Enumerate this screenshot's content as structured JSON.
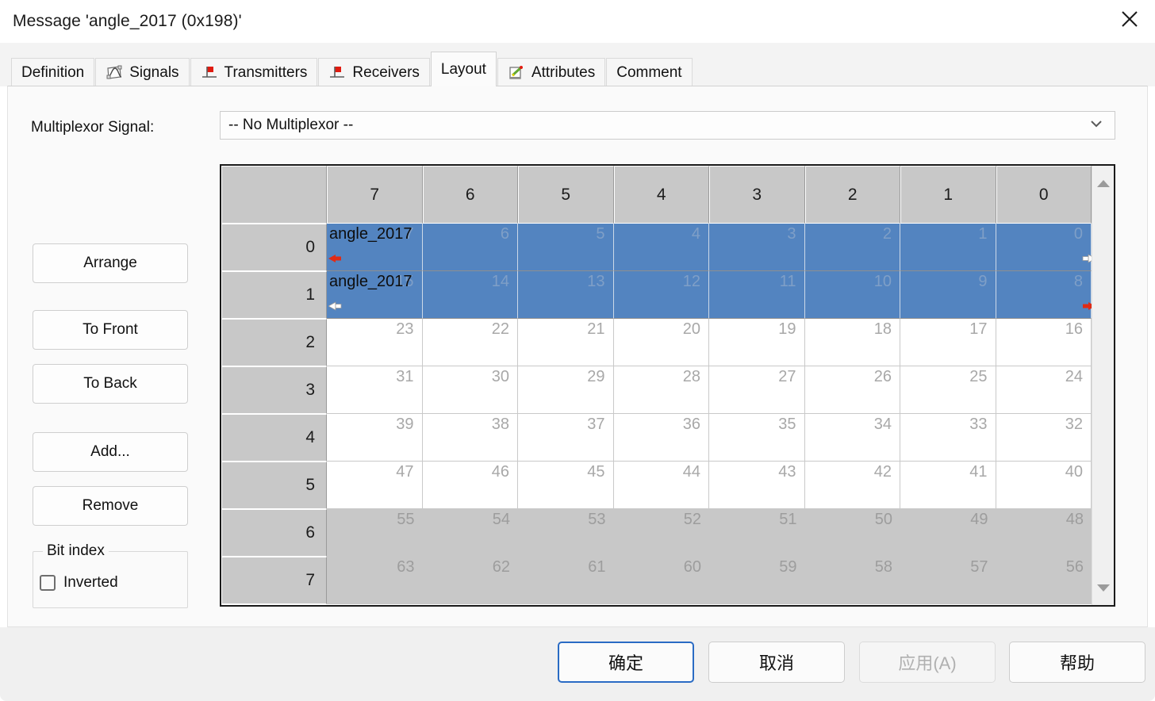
{
  "window": {
    "title": "Message 'angle_2017 (0x198)'",
    "close_icon": "close-icon"
  },
  "tabs": [
    {
      "label": "Definition",
      "icon": "none",
      "active": false
    },
    {
      "label": "Signals",
      "icon": "signals-icon",
      "active": false
    },
    {
      "label": "Transmitters",
      "icon": "pin-icon",
      "active": false
    },
    {
      "label": "Receivers",
      "icon": "pin-icon",
      "active": false
    },
    {
      "label": "Layout",
      "icon": "none",
      "active": true
    },
    {
      "label": "Attributes",
      "icon": "attributes-icon",
      "active": false
    },
    {
      "label": "Comment",
      "icon": "none",
      "active": false
    }
  ],
  "layout": {
    "mux_label": "Multiplexor Signal:",
    "mux_value": "-- No Multiplexor --",
    "buttons": {
      "arrange": "Arrange",
      "to_front": "To Front",
      "to_back": "To Back",
      "add": "Add...",
      "remove": "Remove"
    },
    "bit_index": {
      "legend": "Bit index",
      "inverted_label": "Inverted",
      "inverted_checked": false
    }
  },
  "grid": {
    "corner_header": "",
    "column_headers": [
      "7",
      "6",
      "5",
      "4",
      "3",
      "2",
      "1",
      "0"
    ],
    "rows": [
      {
        "row_label": "0",
        "state": "selected",
        "signal_name": "angle_2017",
        "marker_left": "red-left-arrow",
        "marker_right": "white-right-arrow",
        "cells": [
          "7",
          "6",
          "5",
          "4",
          "3",
          "2",
          "1",
          "0"
        ]
      },
      {
        "row_label": "1",
        "state": "selected",
        "signal_name": "angle_2017",
        "marker_left": "white-left-arrow",
        "marker_right": "red-right-arrow",
        "cells": [
          "15",
          "14",
          "13",
          "12",
          "11",
          "10",
          "9",
          "8"
        ]
      },
      {
        "row_label": "2",
        "state": "normal",
        "signal_name": "",
        "cells": [
          "23",
          "22",
          "21",
          "20",
          "19",
          "18",
          "17",
          "16"
        ]
      },
      {
        "row_label": "3",
        "state": "normal",
        "signal_name": "",
        "cells": [
          "31",
          "30",
          "29",
          "28",
          "27",
          "26",
          "25",
          "24"
        ]
      },
      {
        "row_label": "4",
        "state": "normal",
        "signal_name": "",
        "cells": [
          "39",
          "38",
          "37",
          "36",
          "35",
          "34",
          "33",
          "32"
        ]
      },
      {
        "row_label": "5",
        "state": "normal",
        "signal_name": "",
        "cells": [
          "47",
          "46",
          "45",
          "44",
          "43",
          "42",
          "41",
          "40"
        ]
      },
      {
        "row_label": "6",
        "state": "dimmed",
        "signal_name": "",
        "cells": [
          "55",
          "54",
          "53",
          "52",
          "51",
          "50",
          "49",
          "48"
        ]
      },
      {
        "row_label": "7",
        "state": "dimmed",
        "signal_name": "",
        "cells": [
          "63",
          "62",
          "61",
          "60",
          "59",
          "58",
          "57",
          "56"
        ]
      }
    ],
    "scrollbar": {
      "up_icon": "scroll-up-arrow-icon",
      "down_icon": "scroll-down-arrow-icon"
    }
  },
  "footer": {
    "ok": "确定",
    "cancel": "取消",
    "apply": "应用(A)",
    "help": "帮助",
    "apply_disabled": true
  },
  "colors": {
    "selection_blue": "#5384c0",
    "header_gray": "#c8c8c8",
    "marker_red": "#e02b15",
    "default_button_border": "#2a6bc4"
  }
}
